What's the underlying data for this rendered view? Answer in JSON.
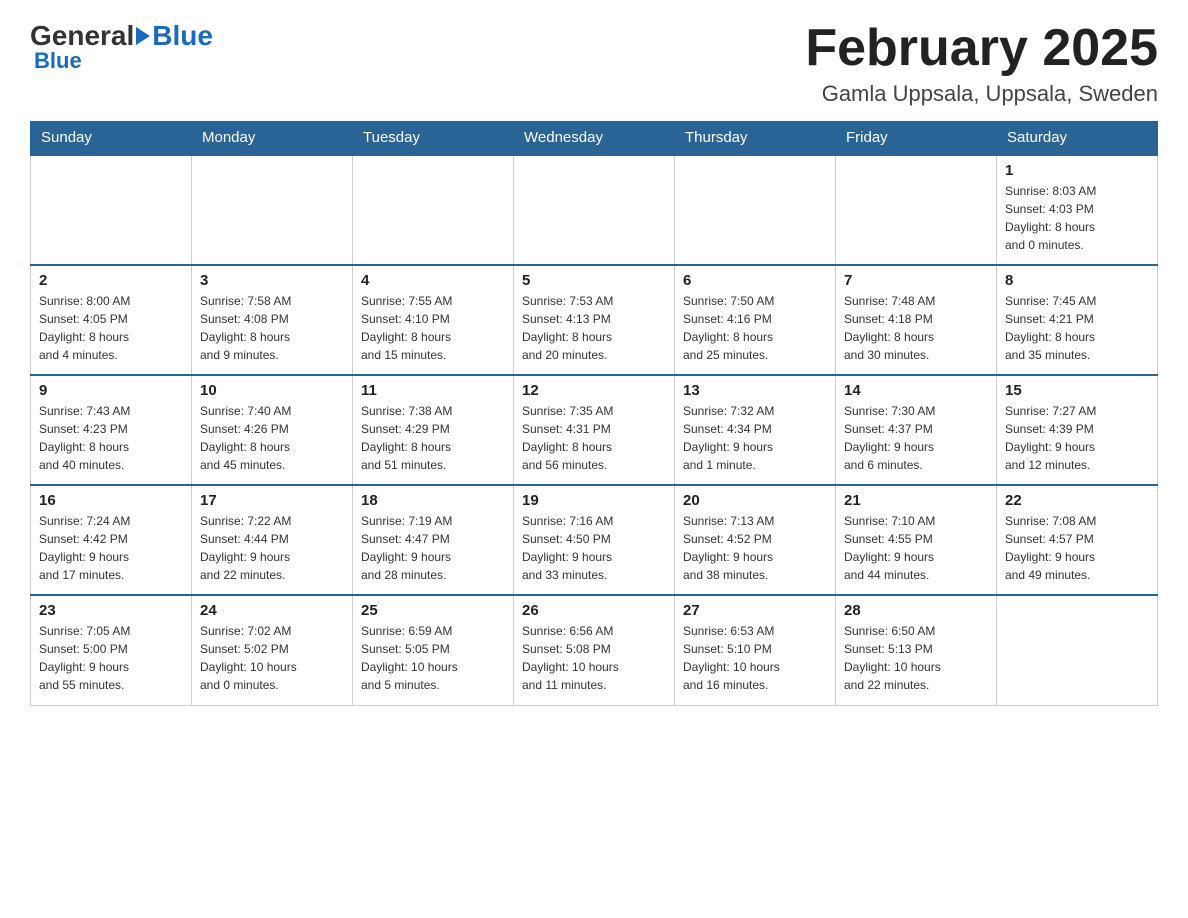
{
  "header": {
    "logo_general": "General",
    "logo_blue": "Blue",
    "month_title": "February 2025",
    "location": "Gamla Uppsala, Uppsala, Sweden"
  },
  "days_of_week": [
    "Sunday",
    "Monday",
    "Tuesday",
    "Wednesday",
    "Thursday",
    "Friday",
    "Saturday"
  ],
  "weeks": [
    [
      {
        "day": "",
        "info": ""
      },
      {
        "day": "",
        "info": ""
      },
      {
        "day": "",
        "info": ""
      },
      {
        "day": "",
        "info": ""
      },
      {
        "day": "",
        "info": ""
      },
      {
        "day": "",
        "info": ""
      },
      {
        "day": "1",
        "info": "Sunrise: 8:03 AM\nSunset: 4:03 PM\nDaylight: 8 hours\nand 0 minutes."
      }
    ],
    [
      {
        "day": "2",
        "info": "Sunrise: 8:00 AM\nSunset: 4:05 PM\nDaylight: 8 hours\nand 4 minutes."
      },
      {
        "day": "3",
        "info": "Sunrise: 7:58 AM\nSunset: 4:08 PM\nDaylight: 8 hours\nand 9 minutes."
      },
      {
        "day": "4",
        "info": "Sunrise: 7:55 AM\nSunset: 4:10 PM\nDaylight: 8 hours\nand 15 minutes."
      },
      {
        "day": "5",
        "info": "Sunrise: 7:53 AM\nSunset: 4:13 PM\nDaylight: 8 hours\nand 20 minutes."
      },
      {
        "day": "6",
        "info": "Sunrise: 7:50 AM\nSunset: 4:16 PM\nDaylight: 8 hours\nand 25 minutes."
      },
      {
        "day": "7",
        "info": "Sunrise: 7:48 AM\nSunset: 4:18 PM\nDaylight: 8 hours\nand 30 minutes."
      },
      {
        "day": "8",
        "info": "Sunrise: 7:45 AM\nSunset: 4:21 PM\nDaylight: 8 hours\nand 35 minutes."
      }
    ],
    [
      {
        "day": "9",
        "info": "Sunrise: 7:43 AM\nSunset: 4:23 PM\nDaylight: 8 hours\nand 40 minutes."
      },
      {
        "day": "10",
        "info": "Sunrise: 7:40 AM\nSunset: 4:26 PM\nDaylight: 8 hours\nand 45 minutes."
      },
      {
        "day": "11",
        "info": "Sunrise: 7:38 AM\nSunset: 4:29 PM\nDaylight: 8 hours\nand 51 minutes."
      },
      {
        "day": "12",
        "info": "Sunrise: 7:35 AM\nSunset: 4:31 PM\nDaylight: 8 hours\nand 56 minutes."
      },
      {
        "day": "13",
        "info": "Sunrise: 7:32 AM\nSunset: 4:34 PM\nDaylight: 9 hours\nand 1 minute."
      },
      {
        "day": "14",
        "info": "Sunrise: 7:30 AM\nSunset: 4:37 PM\nDaylight: 9 hours\nand 6 minutes."
      },
      {
        "day": "15",
        "info": "Sunrise: 7:27 AM\nSunset: 4:39 PM\nDaylight: 9 hours\nand 12 minutes."
      }
    ],
    [
      {
        "day": "16",
        "info": "Sunrise: 7:24 AM\nSunset: 4:42 PM\nDaylight: 9 hours\nand 17 minutes."
      },
      {
        "day": "17",
        "info": "Sunrise: 7:22 AM\nSunset: 4:44 PM\nDaylight: 9 hours\nand 22 minutes."
      },
      {
        "day": "18",
        "info": "Sunrise: 7:19 AM\nSunset: 4:47 PM\nDaylight: 9 hours\nand 28 minutes."
      },
      {
        "day": "19",
        "info": "Sunrise: 7:16 AM\nSunset: 4:50 PM\nDaylight: 9 hours\nand 33 minutes."
      },
      {
        "day": "20",
        "info": "Sunrise: 7:13 AM\nSunset: 4:52 PM\nDaylight: 9 hours\nand 38 minutes."
      },
      {
        "day": "21",
        "info": "Sunrise: 7:10 AM\nSunset: 4:55 PM\nDaylight: 9 hours\nand 44 minutes."
      },
      {
        "day": "22",
        "info": "Sunrise: 7:08 AM\nSunset: 4:57 PM\nDaylight: 9 hours\nand 49 minutes."
      }
    ],
    [
      {
        "day": "23",
        "info": "Sunrise: 7:05 AM\nSunset: 5:00 PM\nDaylight: 9 hours\nand 55 minutes."
      },
      {
        "day": "24",
        "info": "Sunrise: 7:02 AM\nSunset: 5:02 PM\nDaylight: 10 hours\nand 0 minutes."
      },
      {
        "day": "25",
        "info": "Sunrise: 6:59 AM\nSunset: 5:05 PM\nDaylight: 10 hours\nand 5 minutes."
      },
      {
        "day": "26",
        "info": "Sunrise: 6:56 AM\nSunset: 5:08 PM\nDaylight: 10 hours\nand 11 minutes."
      },
      {
        "day": "27",
        "info": "Sunrise: 6:53 AM\nSunset: 5:10 PM\nDaylight: 10 hours\nand 16 minutes."
      },
      {
        "day": "28",
        "info": "Sunrise: 6:50 AM\nSunset: 5:13 PM\nDaylight: 10 hours\nand 22 minutes."
      },
      {
        "day": "",
        "info": ""
      }
    ]
  ]
}
